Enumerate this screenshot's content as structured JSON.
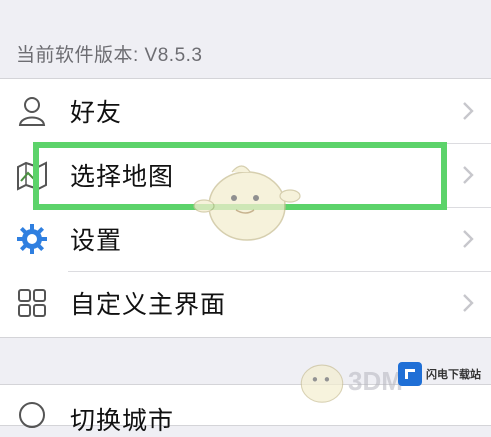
{
  "header": {
    "version_text": "当前软件版本: V8.5.3"
  },
  "menu": {
    "items": [
      {
        "label": "好友",
        "icon": "person-icon"
      },
      {
        "label": "选择地图",
        "icon": "map-icon"
      },
      {
        "label": "设置",
        "icon": "gear-icon"
      },
      {
        "label": "自定义主界面",
        "icon": "grid-icon"
      }
    ],
    "partial_item": {
      "label": "切换城市",
      "icon": "city-icon"
    }
  },
  "highlight": {
    "color": "#5cd36a",
    "target": "选择地图"
  },
  "watermark": {
    "site_name": "闪电下载站",
    "text_3dm": "3DM"
  },
  "colors": {
    "background": "#efeff4",
    "accent_gear": "#2f7fe0",
    "chevron": "#c7c7cc"
  }
}
